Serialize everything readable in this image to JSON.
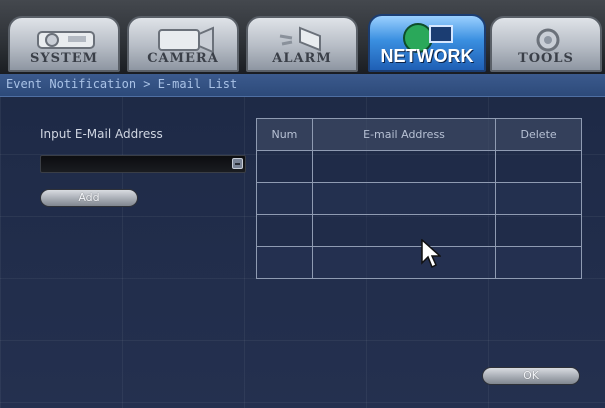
{
  "tabs": [
    {
      "label": "SYSTEM",
      "icon": "projector-icon"
    },
    {
      "label": "CAMERA",
      "icon": "camera-icon"
    },
    {
      "label": "ALARM",
      "icon": "alarm-icon"
    },
    {
      "label": "NETWORK",
      "icon": "network-icon",
      "active": true
    },
    {
      "label": "TOOLS",
      "icon": "tools-icon"
    }
  ],
  "breadcrumb": "Event Notification > E-mail List",
  "input": {
    "label": "Input E-Mail Address",
    "value": ""
  },
  "buttons": {
    "add": "Add",
    "ok": "OK"
  },
  "table": {
    "columns": [
      "Num",
      "E-mail Address",
      "Delete"
    ],
    "rows": [
      {
        "num": "",
        "email": "",
        "delete": ""
      },
      {
        "num": "",
        "email": "",
        "delete": ""
      },
      {
        "num": "",
        "email": "",
        "delete": ""
      },
      {
        "num": "",
        "email": "",
        "delete": ""
      }
    ]
  },
  "colors": {
    "accent": "#2d4a7a",
    "active_tab": "#3a8fe0",
    "background": "#1f2b48"
  }
}
